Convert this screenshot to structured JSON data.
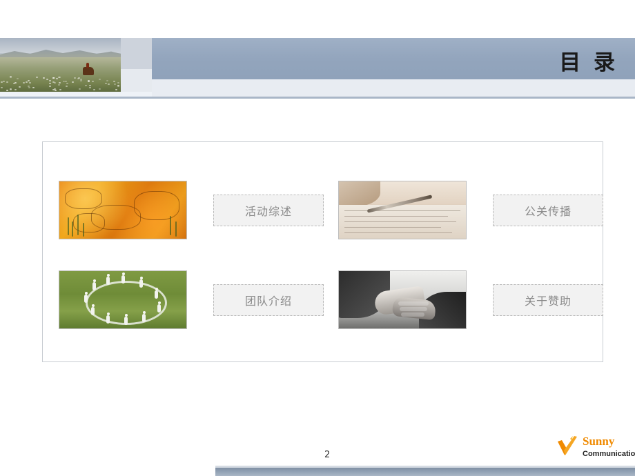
{
  "slide": {
    "title": "目 录",
    "page_number": "2"
  },
  "header": {
    "photo_alt": "grassland-horse-photo"
  },
  "contents": [
    {
      "id": "item-1",
      "thumb": "orange-map-image",
      "label": "活动综述"
    },
    {
      "id": "item-2",
      "thumb": "desk-pen-newspaper-image",
      "label": "公关传播"
    },
    {
      "id": "item-3",
      "thumb": "team-circle-grass-image",
      "label": "团队介绍"
    },
    {
      "id": "item-4",
      "thumb": "handshake-image",
      "label": "关于赞助"
    }
  ],
  "logo": {
    "main": "Sunny",
    "sub": "Communication",
    "accent_color": "#f08a00"
  }
}
